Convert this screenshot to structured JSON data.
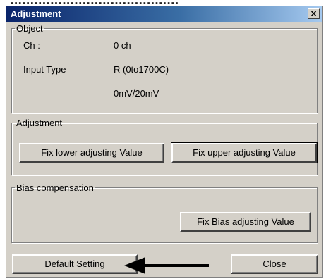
{
  "window": {
    "title": "Adjustment",
    "close_glyph": "×"
  },
  "object_group": {
    "legend": "Object",
    "ch_label": "Ch :",
    "ch_value": "0 ch",
    "input_type_label": "Input Type",
    "input_type_value": "R (0to1700C)",
    "range_value": "0mV/20mV"
  },
  "adjustment_group": {
    "legend": "Adjustment",
    "fix_lower_label": "Fix lower adjusting Value",
    "fix_upper_label": "Fix upper adjusting Value"
  },
  "bias_group": {
    "legend": "Bias compensation",
    "fix_bias_label": "Fix Bias adjusting Value"
  },
  "footer": {
    "default_setting_label": "Default Setting",
    "close_label": "Close"
  },
  "colors": {
    "title_start": "#0a246a",
    "title_end": "#a6caf0",
    "face": "#d4d0c8"
  }
}
